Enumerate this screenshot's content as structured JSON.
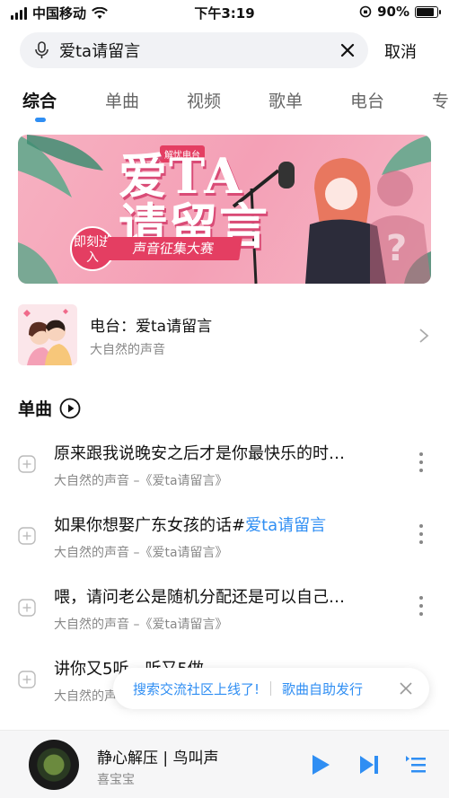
{
  "status": {
    "carrier": "中国移动",
    "time": "下午3:19",
    "battery": "90%",
    "battery_level": 0.9
  },
  "search": {
    "query": "爱ta请留言",
    "cancel": "取消"
  },
  "tabs": [
    {
      "label": "综合",
      "active": true
    },
    {
      "label": "单曲"
    },
    {
      "label": "视频"
    },
    {
      "label": "歌单"
    },
    {
      "label": "电台"
    },
    {
      "label": "专"
    }
  ],
  "banner": {
    "tag": "解忧电台",
    "big_title": "爱TA\n请留言",
    "subtitle": "声音征集大赛",
    "join": "即刻进入"
  },
  "radio": {
    "title": "电台：爱ta请留言",
    "subtitle": "大自然的声音"
  },
  "section": {
    "title": "单曲"
  },
  "songs": [
    {
      "title": "原来跟我说晚安之后才是你最快乐的时…",
      "meta": "大自然的声音 –《爱ta请留言》"
    },
    {
      "title_plain": "如果你想娶广东女孩的话#",
      "title_highlight": "爱ta请留言",
      "meta": "大自然的声音 –《爱ta请留言》"
    },
    {
      "title": "喂，请问老公是随机分配还是可以自己…",
      "meta": "大自然的声音 –《爱ta请留言》"
    },
    {
      "title": "讲你又5听，听又5做",
      "meta": "大自然的声音 –《爱ta请留言》"
    }
  ],
  "toast": {
    "left": "搜索交流社区上线了!",
    "right": "歌曲自助发行"
  },
  "player": {
    "title": "静心解压 | 鸟叫声",
    "artist": "喜宝宝"
  },
  "colors": {
    "accent": "#2f8ef3",
    "banner_pink": "#f4a0b6",
    "banner_red": "#e43e62"
  },
  "icons": [
    "wifi-icon",
    "lock-rotation-icon",
    "mic-icon",
    "close-icon",
    "chevron-right-icon",
    "play-circle-icon",
    "add-icon",
    "more-icon",
    "play-icon",
    "next-icon",
    "playlist-icon"
  ]
}
